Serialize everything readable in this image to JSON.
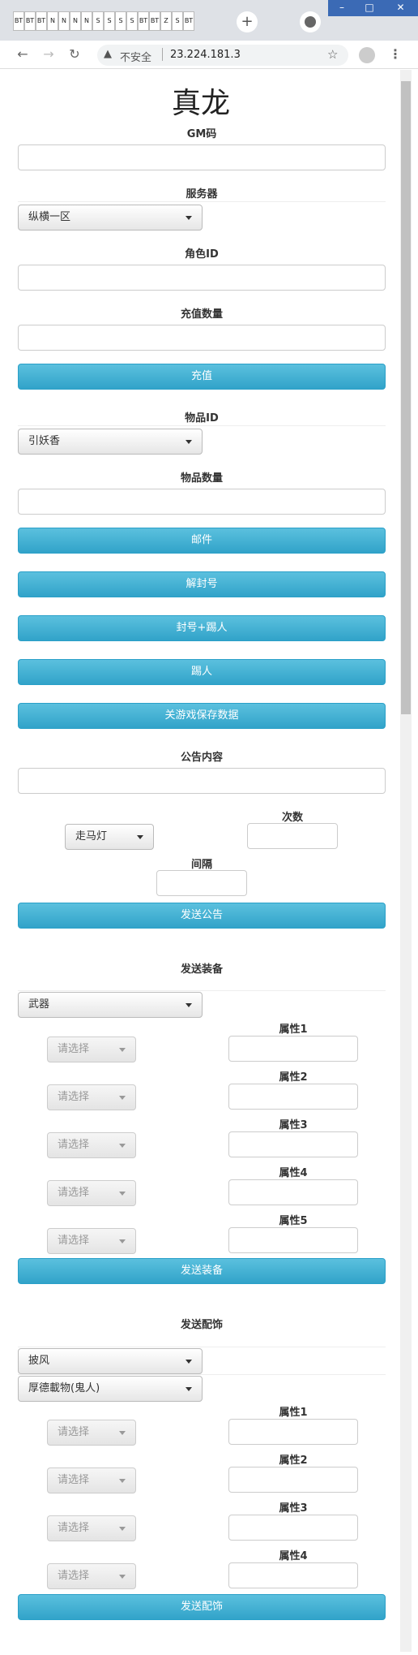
{
  "browser": {
    "tab_icons": [
      "BT",
      "BT",
      "BT",
      "N",
      "N",
      "N",
      "N",
      "S",
      "S",
      "S",
      "S",
      "BT",
      "BT",
      "Z",
      "S",
      "BT"
    ],
    "new_tab": "+",
    "window_min": "–",
    "window_max": "□",
    "window_close": "✕",
    "security": "不安全",
    "url": "23.224.181.3"
  },
  "page": {
    "title": "真龙",
    "gm_label": "GM码",
    "server_label": "服务器",
    "server_value": "纵横一区",
    "role_label": "角色ID",
    "recharge_label": "充值数量",
    "recharge_btn": "充值",
    "item_label": "物品ID",
    "item_value": "引妖香",
    "item_count_label": "物品数量",
    "mail_btn": "邮件",
    "unban_btn": "解封号",
    "ban_kick_btn": "封号+踢人",
    "kick_btn": "踢人",
    "shutdown_btn": "关游戏保存数据",
    "notice_label": "公告内容",
    "notice_type": "走马灯",
    "times_label": "次数",
    "interval_label": "间隔",
    "notice_btn": "发送公告",
    "equip_section": "发送装备",
    "equip_type": "武器",
    "equip_attrs": [
      {
        "label": "属性1",
        "select": "请选择"
      },
      {
        "label": "属性2",
        "select": "请选择"
      },
      {
        "label": "属性3",
        "select": "请选择"
      },
      {
        "label": "属性4",
        "select": "请选择"
      },
      {
        "label": "属性5",
        "select": "请选择"
      }
    ],
    "equip_btn": "发送装备",
    "acc_section": "发送配饰",
    "acc_type": "披风",
    "acc_item": "厚德載物(鬼人)",
    "acc_attrs": [
      {
        "label": "属性1",
        "select": "请选择"
      },
      {
        "label": "属性2",
        "select": "请选择"
      },
      {
        "label": "属性3",
        "select": "请选择"
      },
      {
        "label": "属性4",
        "select": "请选择"
      }
    ],
    "acc_btn": "发送配饰"
  }
}
